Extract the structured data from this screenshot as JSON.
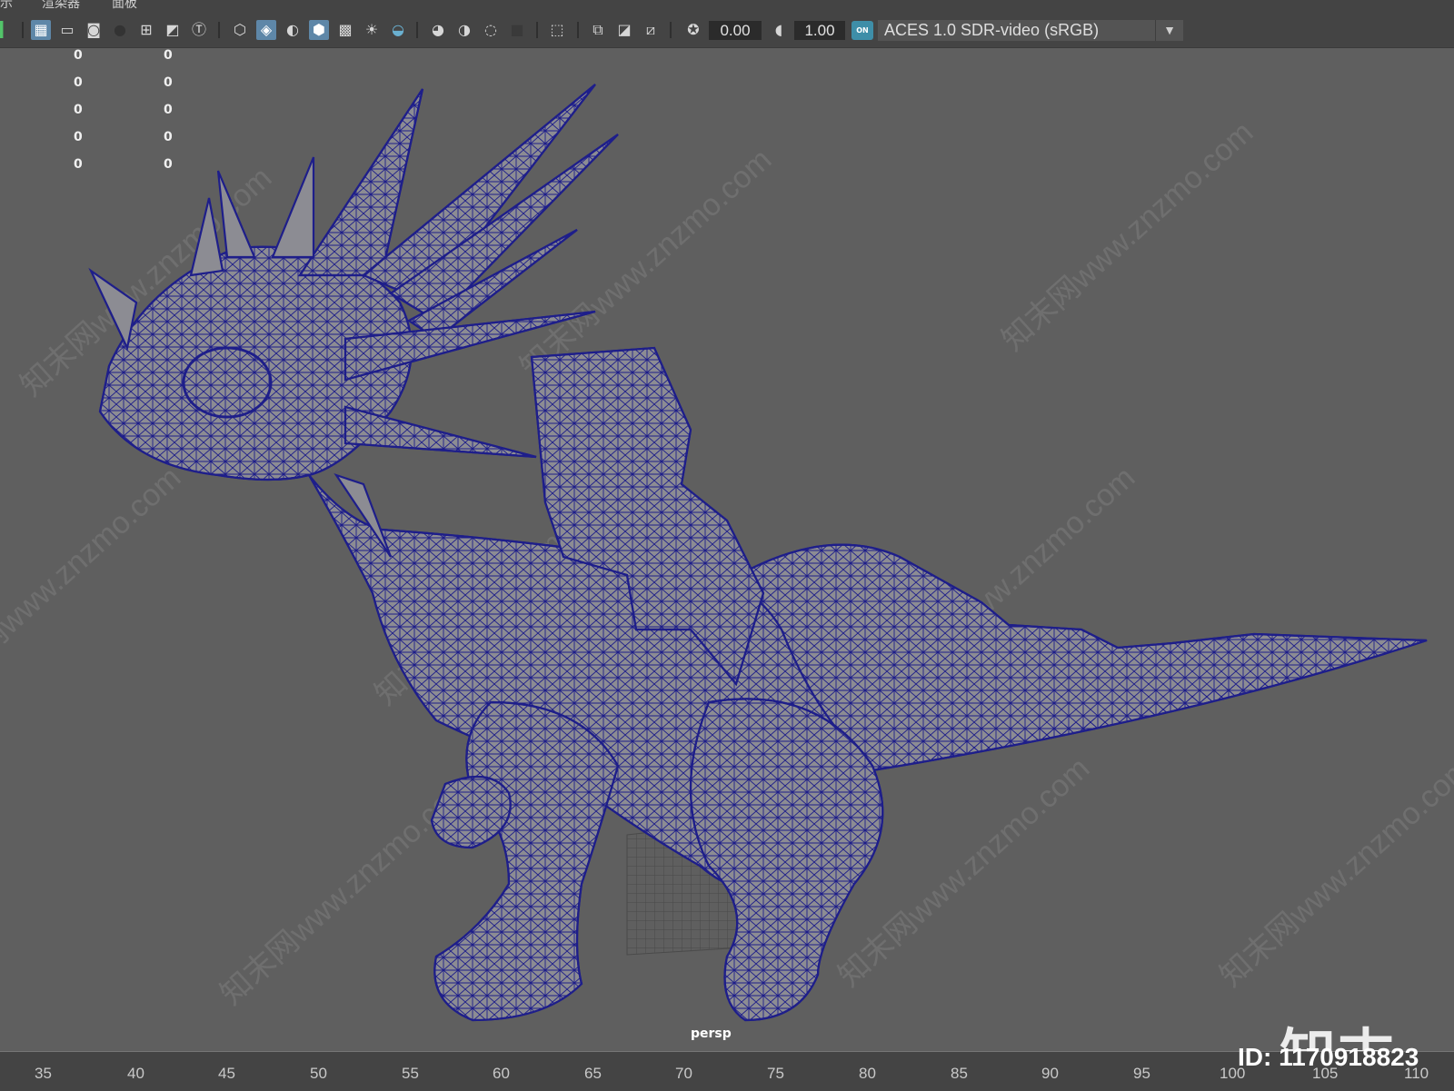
{
  "menu": {
    "items": [
      "示",
      "渲染器",
      "面板"
    ]
  },
  "toolbar": {
    "exposure_value": "0.00",
    "gamma_value": "1.00",
    "colorspace_on_badge": "ON",
    "colorspace": "ACES 1.0 SDR-video (sRGB)",
    "icons": [
      "grid-icon",
      "film-gate-icon",
      "resolution-gate-icon",
      "gate-mask-icon",
      "field-chart-icon",
      "safe-action-icon",
      "safe-title-icon",
      "wireframe-icon",
      "smooth-shade-icon",
      "default-material-icon",
      "wireframe-on-shaded-icon",
      "xray-icon",
      "use-all-lights-icon",
      "shadows-icon",
      "screen-space-ao-icon",
      "motion-blur-icon",
      "multisample-aa-icon",
      "depth-of-field-icon",
      "isolate-select-icon",
      "xray-joints-icon",
      "xray-active-icon",
      "backface-cull-icon",
      "exposure-icon",
      "gamma-icon",
      "colorspace-icon"
    ]
  },
  "hud": {
    "col1": [
      "0",
      "0",
      "0",
      "0",
      "0"
    ],
    "col2": [
      "0",
      "0",
      "0",
      "0",
      "0"
    ]
  },
  "viewport": {
    "camera_label": "persp",
    "watermark_logo": "知末",
    "watermark_text": "知末网www.znzmo.com",
    "model": "dragon-wireframe",
    "wire_color": "#1e1e8a",
    "surface_color": "#8a8a90",
    "background_color": "#5f5f5f"
  },
  "image_id": "ID: 1170918823",
  "timeslider": {
    "ticks": [
      "35",
      "40",
      "45",
      "50",
      "55",
      "60",
      "65",
      "70",
      "75",
      "80",
      "85",
      "90",
      "95",
      "100",
      "105",
      "110"
    ]
  }
}
